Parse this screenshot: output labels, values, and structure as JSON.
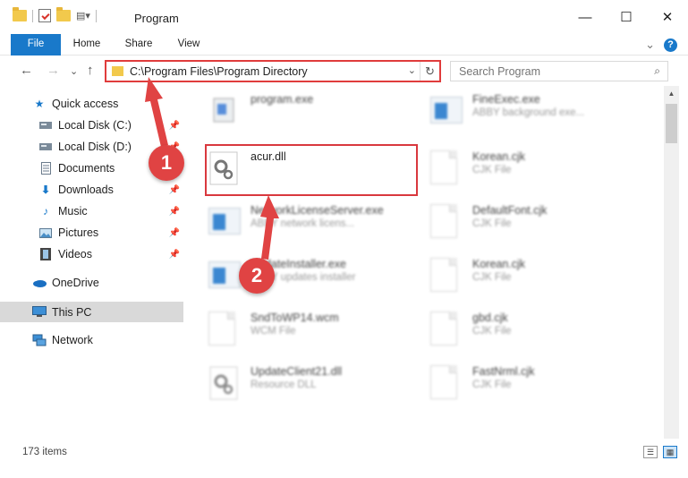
{
  "window": {
    "title": "Program",
    "minimize": "—",
    "maximize": "☐",
    "close": "✕"
  },
  "ribbon": {
    "tabs": [
      "File",
      "Home",
      "Share",
      "View"
    ],
    "expand": "⌄",
    "help": "?"
  },
  "nav": {
    "back": "←",
    "forward": "→",
    "recent": "⌄",
    "up": "↑",
    "address": "C:\\Program Files\\Program Directory",
    "dropdown": "⌄",
    "refresh": "↻",
    "search_placeholder": "Search Program"
  },
  "sidebar": {
    "items": [
      {
        "label": "Quick access",
        "icon": "star-icon"
      },
      {
        "label": "Local Disk (C:)",
        "icon": "drive-icon",
        "pinned": true
      },
      {
        "label": "Local Disk (D:)",
        "icon": "drive-icon",
        "pinned": true
      },
      {
        "label": "Documents",
        "icon": "documents-icon"
      },
      {
        "label": "Downloads",
        "icon": "download-icon",
        "pinned": true
      },
      {
        "label": "Music",
        "icon": "music-icon",
        "pinned": true
      },
      {
        "label": "Pictures",
        "icon": "pictures-icon",
        "pinned": true
      },
      {
        "label": "Videos",
        "icon": "videos-icon",
        "pinned": true
      },
      {
        "label": "OneDrive",
        "icon": "cloud-icon"
      },
      {
        "label": "This PC",
        "icon": "computer-icon",
        "selected": true
      },
      {
        "label": "Network",
        "icon": "network-icon"
      }
    ]
  },
  "files": [
    {
      "name": "program.exe",
      "desc": "",
      "icon": "program-icon"
    },
    {
      "name": "FineExec.exe",
      "desc": "ABBY background exe...",
      "icon": "app-icon"
    },
    {
      "name": "acur.dll",
      "desc": "",
      "icon": "dll-icon",
      "highlighted": true
    },
    {
      "name": "Korean.cjk",
      "desc": "CJK File",
      "icon": "file-icon"
    },
    {
      "name": "NetworkLicenseServer.exe",
      "desc": "ABBY network licens...",
      "icon": "app-icon"
    },
    {
      "name": "DefaultFont.cjk",
      "desc": "CJK File",
      "icon": "file-icon"
    },
    {
      "name": "UpdateInstaller.exe",
      "desc": "ABBY updates installer",
      "icon": "app-icon"
    },
    {
      "name": "Korean.cjk",
      "desc": "CJK File",
      "icon": "file-icon"
    },
    {
      "name": "SndToWP14.wcm",
      "desc": "WCM File",
      "icon": "file-icon"
    },
    {
      "name": "gbd.cjk",
      "desc": "CJK File",
      "icon": "file-icon"
    },
    {
      "name": "UpdateClient21.dll",
      "desc": "Resource DLL",
      "icon": "dll-icon"
    },
    {
      "name": "FastNrml.cjk",
      "desc": "CJK File",
      "icon": "file-icon"
    }
  ],
  "status": {
    "count": "173 items",
    "details_view": "☰",
    "tiles_view": "▦"
  },
  "annotations": {
    "step1": "1",
    "step2": "2",
    "color": "#e04343"
  }
}
